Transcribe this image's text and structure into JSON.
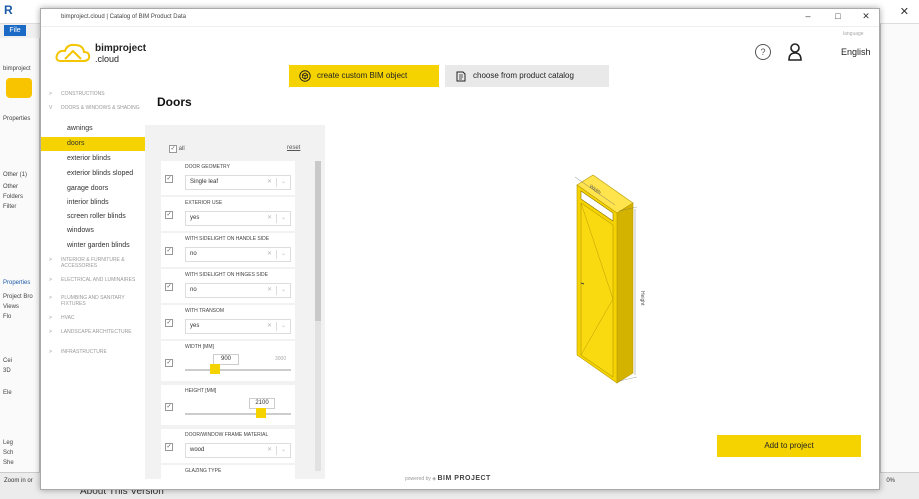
{
  "host": {
    "logo": "R",
    "file_label": "File",
    "close_glyph": "✕",
    "left_labels": [
      "bimproject",
      "Properties",
      "Other (1)",
      "Other",
      "Folders",
      "Filter",
      "Properties",
      "Project Bro",
      "Views",
      "Flo",
      "Cei",
      "3D",
      "Ele",
      "Leg",
      "Sch",
      "She",
      "Zoom in or"
    ],
    "about": "About This Version",
    "zoom_pct": "0%"
  },
  "window": {
    "title": "bimproject.cloud | Catalog of BIM Product Data",
    "minimize": "–",
    "maximize": "□",
    "close": "✕"
  },
  "header": {
    "logo_line1": "bimproject",
    "logo_line2": ".cloud",
    "help_glyph": "?",
    "language_caption": "language",
    "language": "English"
  },
  "modes": {
    "custom": "create custom BIM object",
    "catalog": "choose from product catalog"
  },
  "nav": {
    "categories": [
      {
        "label": "CONSTRUCTIONS",
        "arrow": ">"
      },
      {
        "label": "DOORS & WINDOWS & SHADING",
        "arrow": "v"
      },
      {
        "label": "INTERIOR & FURNITURE & ACCESSORIES",
        "arrow": ">"
      },
      {
        "label": "ELECTRICAL AND LUMINAIRES",
        "arrow": ">"
      },
      {
        "label": "PLUMBING AND SANITARY FIXTURES",
        "arrow": ">"
      },
      {
        "label": "HVAC",
        "arrow": ">"
      },
      {
        "label": "LANDSCAPE ARCHITECTURE",
        "arrow": ">"
      },
      {
        "label": "INFRASTRUCTURE",
        "arrow": ">"
      }
    ],
    "subitems": [
      "awnings",
      "doors",
      "exterior blinds",
      "exterior blinds sloped",
      "garage doors",
      "interior blinds",
      "screen roller blinds",
      "windows",
      "winter garden blinds"
    ]
  },
  "page_title": "Doors",
  "filters": {
    "all_label": "all",
    "reset_label": "reset",
    "checkmark": "✓",
    "clear_glyph": "✕",
    "chevron_glyph": "⌄",
    "door_geometry": {
      "label": "DOOR GEOMETRY",
      "value": "Single leaf"
    },
    "exterior_use": {
      "label": "EXTERIOR USE",
      "value": "yes"
    },
    "sidelight_handle": {
      "label": "WITH SIDELIGHT ON HANDLE SIDE",
      "value": "no"
    },
    "sidelight_hinges": {
      "label": "WITH SIDELIGHT ON HINGES SIDE",
      "value": "no"
    },
    "transom": {
      "label": "WITH TRANSOM",
      "value": "yes"
    },
    "width": {
      "label": "WIDTH [mm]",
      "value": "900",
      "min": "",
      "max": "3000",
      "level": 0.28
    },
    "height": {
      "label": "HEIGHT [mm]",
      "value": "2100",
      "min": "",
      "max": "",
      "level": 0.72
    },
    "frame_material": {
      "label": "DOOR/WINDOW FRAME MATERIAL",
      "value": "wood"
    },
    "glazing_type": {
      "label": "GLAZING TYPE",
      "value": ""
    }
  },
  "preview": {
    "width_label": "Width",
    "height_label": "Height"
  },
  "actions": {
    "add_to_project": "Add to project"
  },
  "footer": {
    "powered_by": "powered by",
    "brand": "BIM PROJECT"
  }
}
